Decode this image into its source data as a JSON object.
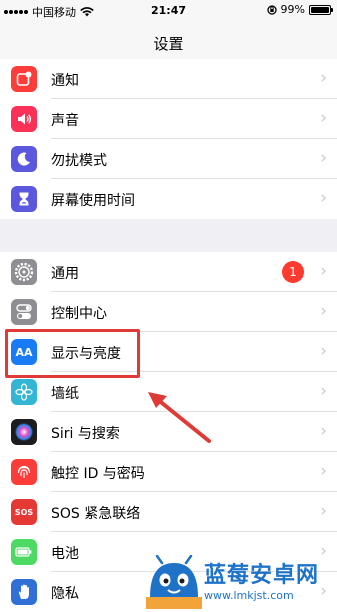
{
  "status_bar": {
    "carrier": "中国移动",
    "time": "21:47",
    "battery": "99%",
    "battery_level": 0.99
  },
  "nav": {
    "title": "设置"
  },
  "groups": [
    {
      "rows": [
        {
          "label": "通知",
          "icon": "notification-icon",
          "color": "#fc3d39"
        },
        {
          "label": "声音",
          "icon": "speaker-icon",
          "color": "#fc3158"
        },
        {
          "label": "勿扰模式",
          "icon": "moon-icon",
          "color": "#5b58de"
        },
        {
          "label": "屏幕使用时间",
          "icon": "hourglass-icon",
          "color": "#5b58de"
        }
      ]
    },
    {
      "rows": [
        {
          "label": "通用",
          "icon": "gear-icon",
          "color": "#8e8e93",
          "badge": "1"
        },
        {
          "label": "控制中心",
          "icon": "toggles-icon",
          "color": "#8e8e93"
        },
        {
          "label": "显示与亮度",
          "icon": "display-brightness-icon",
          "color": "#1a7cf5",
          "icon_text": "AA"
        },
        {
          "label": "墙纸",
          "icon": "flower-icon",
          "color": "#33b5d4"
        },
        {
          "label": "Siri 与搜索",
          "icon": "siri-icon",
          "color": "#1d1d1f"
        },
        {
          "label": "触控 ID 与密码",
          "icon": "fingerprint-icon",
          "color": "#fc3d39"
        },
        {
          "label": "SOS 紧急联络",
          "icon": "sos-icon",
          "color": "#e53935",
          "icon_text": "SOS"
        },
        {
          "label": "电池",
          "icon": "battery-icon",
          "color": "#4cd964"
        },
        {
          "label": "隐私",
          "icon": "hand-icon",
          "color": "#2f6fd6"
        }
      ]
    }
  ],
  "watermark": {
    "title": "蓝莓安卓网",
    "url": "www.lmkjst.com"
  }
}
